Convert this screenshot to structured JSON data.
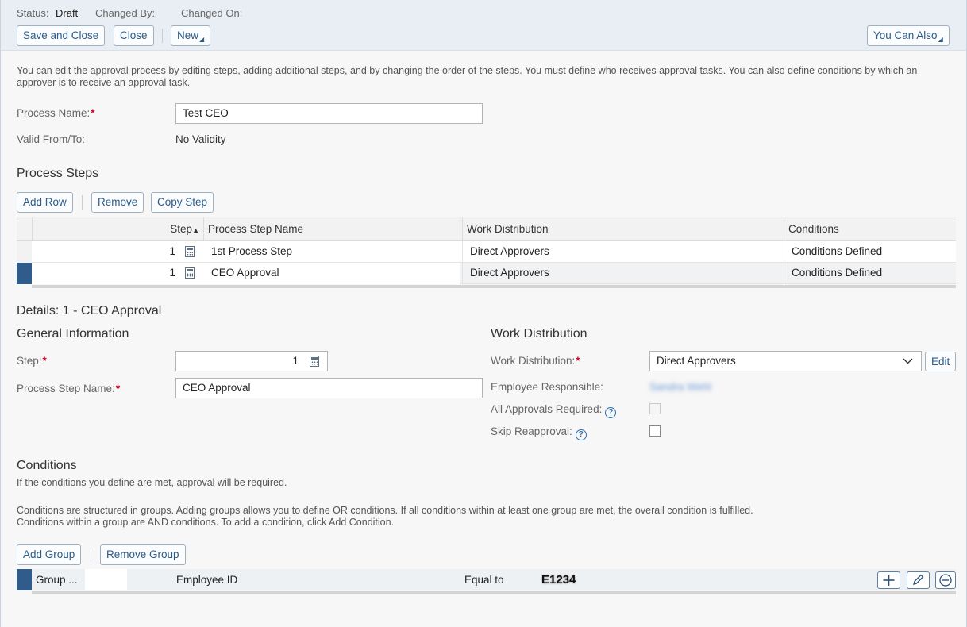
{
  "header": {
    "status_label": "Status:",
    "status_value": "Draft",
    "changed_by_label": "Changed By:",
    "changed_on_label": "Changed On:",
    "buttons": {
      "save_and_close": "Save and Close",
      "close": "Close",
      "new": "New",
      "you_can_also": "You Can Also"
    }
  },
  "intro_text": "You can edit the approval process by editing steps, adding additional steps, and by changing the order of the steps. You must define who receives approval tasks. You can also define conditions by which an approver is to receive an approval task.",
  "form": {
    "process_name_label": "Process Name:",
    "process_name_value": "Test CEO",
    "valid_label": "Valid From/To:",
    "valid_value": "No Validity"
  },
  "process_steps": {
    "title": "Process Steps",
    "buttons": {
      "add_row": "Add Row",
      "remove": "Remove",
      "copy_step": "Copy Step"
    },
    "columns": {
      "step": "Step",
      "name": "Process Step Name",
      "work": "Work Distribution",
      "conditions": "Conditions"
    },
    "rows": [
      {
        "step": "1",
        "name": "1st Process Step",
        "work": "Direct Approvers",
        "conditions": "Conditions Defined"
      },
      {
        "step": "1",
        "name": "CEO Approval",
        "work": "Direct Approvers",
        "conditions": "Conditions Defined"
      }
    ]
  },
  "details": {
    "title": "Details: 1 - CEO Approval",
    "general_title": "General Information",
    "step_label": "Step:",
    "step_value": "1",
    "step_name_label": "Process Step Name:",
    "step_name_value": "CEO Approval",
    "work_title": "Work Distribution",
    "work_label": "Work Distribution:",
    "work_value": "Direct Approvers",
    "edit_button": "Edit",
    "employee_label": "Employee Responsible:",
    "employee_value": "Sandra Wehl",
    "all_approvals_label": "All Approvals Required:",
    "skip_label": "Skip Reapproval:"
  },
  "conditions": {
    "title": "Conditions",
    "text1": "If the conditions you define are met, approval will be required.",
    "text2": "Conditions are structured in groups. Adding groups allows you to define OR conditions. If all conditions within at least one group are met, the overall condition is fulfilled.",
    "text3": "Conditions within a group are AND conditions. To add a condition, click Add Condition.",
    "buttons": {
      "add_group": "Add Group",
      "remove_group": "Remove Group"
    },
    "row": {
      "group": "Group ...",
      "field": "Employee ID",
      "operator": "Equal to",
      "value": "E1234"
    }
  },
  "colors": {
    "accent": "#2b5c8a",
    "selected_row": "#2f5c8a",
    "required": "#d0021b"
  }
}
